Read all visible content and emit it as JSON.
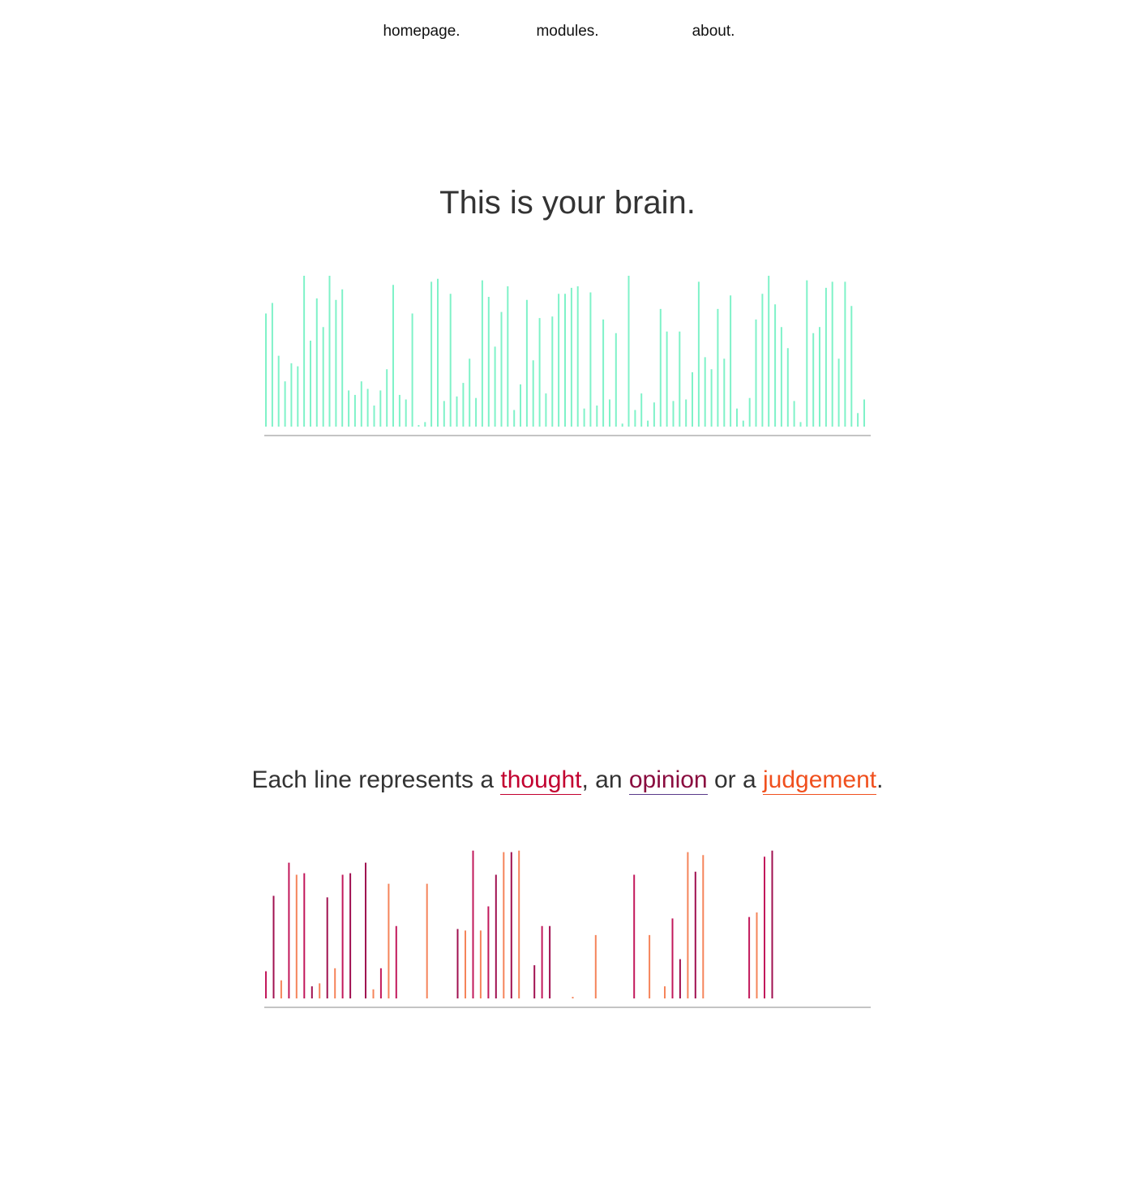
{
  "nav": {
    "items": [
      {
        "label": "homepage."
      },
      {
        "label": "modules."
      },
      {
        "label": "about."
      }
    ]
  },
  "hero": {
    "title": "This is your brain."
  },
  "lead": {
    "prefix": "Each line represents a ",
    "thought": "thought",
    "sep1": ", an ",
    "opinion": "opinion",
    "sep2": " or a ",
    "judgement": "judgement",
    "suffix": "."
  },
  "colors": {
    "brain_line": "#7ff2c8",
    "thought": "#c2185b",
    "opinion": "#a01050",
    "judgement": "#f5845a",
    "baseline": "#888888"
  },
  "chart_data": [
    {
      "type": "bar",
      "title": "",
      "xlabel": "",
      "ylabel": "",
      "ylim": [
        0,
        100
      ],
      "grid": false,
      "values": [
        75,
        82,
        47,
        0,
        30,
        42,
        40,
        0,
        100,
        0,
        57,
        85,
        0,
        66,
        0,
        100,
        0,
        84,
        91,
        0,
        24,
        21,
        30,
        25,
        14,
        24,
        38,
        94,
        21,
        18,
        75,
        1,
        3,
        96,
        98,
        17,
        88,
        20,
        29,
        45,
        19,
        97,
        0,
        86,
        0,
        0,
        53,
        0,
        76,
        0,
        93,
        0,
        0,
        11,
        28,
        84,
        44,
        0,
        72,
        22,
        73,
        0,
        88,
        0,
        0,
        88,
        92,
        93,
        12,
        0,
        89,
        14,
        0,
        71,
        18,
        62,
        2,
        100,
        11,
        22,
        4,
        16,
        78,
        63,
        0,
        17,
        0,
        0,
        63,
        0,
        0,
        0,
        18,
        36,
        96,
        46,
        38,
        0,
        78,
        0,
        45,
        87,
        0,
        12,
        4,
        19,
        71,
        0,
        0,
        0,
        88,
        0,
        0,
        0,
        100,
        0,
        0,
        0,
        81,
        0,
        66,
        52,
        17,
        3,
        97,
        0,
        0,
        62,
        0,
        66,
        0,
        0,
        92,
        0,
        0,
        0,
        0,
        96,
        0,
        0,
        0,
        45,
        0,
        0,
        96,
        0,
        80,
        0,
        9,
        0,
        0,
        0,
        0,
        0,
        18,
        0,
        0,
        0,
        0,
        0,
        0,
        0,
        0,
        0,
        0,
        0,
        0,
        0,
        0
      ],
      "values_note": "",
      "series": [
        {
          "values": [
            75,
            82,
            47,
            30,
            42,
            40,
            100,
            57,
            85,
            66,
            100,
            84,
            91,
            24,
            21,
            30,
            25,
            14,
            24,
            38,
            94,
            21,
            18,
            75,
            1,
            3,
            96,
            98,
            17,
            88,
            20,
            29,
            45,
            19,
            97,
            86,
            53,
            76,
            93,
            11,
            28,
            84,
            44,
            72,
            22,
            73,
            88,
            88,
            92,
            93,
            12,
            89,
            14,
            71,
            18,
            62,
            2,
            100,
            11,
            22,
            4,
            16,
            78,
            63,
            17,
            63,
            18,
            36,
            96,
            46,
            38,
            78,
            45,
            87,
            12,
            4,
            19,
            71,
            88,
            100,
            81,
            66,
            52,
            17,
            3,
            97,
            62,
            66,
            92,
            96,
            45,
            96,
            80,
            9,
            18
          ]
        }
      ]
    },
    {
      "type": "bar",
      "title": "",
      "xlabel": "",
      "ylabel": "",
      "ylim": [
        0,
        100
      ],
      "grid": false,
      "series": [
        {
          "values": [
            18,
            68,
            12,
            90,
            82,
            83,
            8,
            10,
            67,
            20,
            82,
            83,
            0,
            90,
            6,
            20,
            76,
            48,
            0,
            0,
            0,
            76,
            0,
            0,
            0,
            46,
            45,
            98,
            45,
            61,
            82,
            97,
            97,
            98,
            0,
            22,
            48,
            48,
            0,
            0,
            1,
            0,
            0,
            42,
            0,
            0,
            0,
            0,
            82,
            0,
            42,
            0,
            8,
            53,
            26,
            97,
            84,
            95,
            0,
            0,
            0,
            0,
            0,
            54,
            57,
            94,
            98,
            0,
            0,
            0,
            0,
            0,
            0,
            0,
            0,
            0,
            0,
            0,
            0
          ]
        }
      ]
    }
  ]
}
